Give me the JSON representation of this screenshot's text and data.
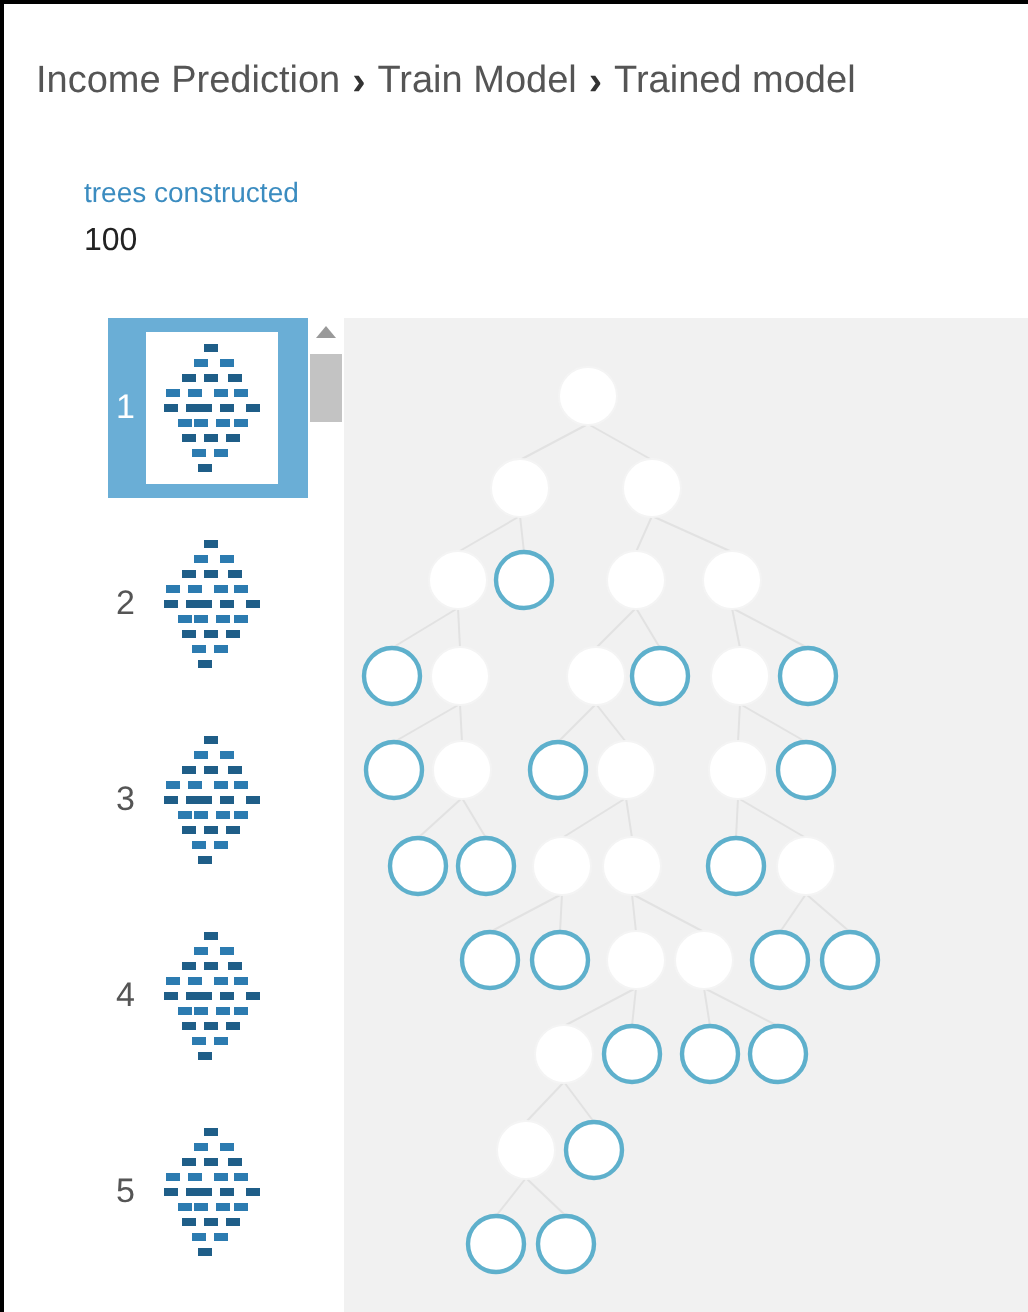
{
  "breadcrumb": [
    {
      "label": "Income Prediction"
    },
    {
      "label": "Train Model"
    },
    {
      "label": "Trained model"
    }
  ],
  "separator": "›",
  "stat": {
    "label": "trees constructed",
    "value": "100"
  },
  "trees": [
    {
      "label": "1",
      "selected": true
    },
    {
      "label": "2",
      "selected": false
    },
    {
      "label": "3",
      "selected": false
    },
    {
      "label": "4",
      "selected": false
    },
    {
      "label": "5",
      "selected": false
    }
  ]
}
